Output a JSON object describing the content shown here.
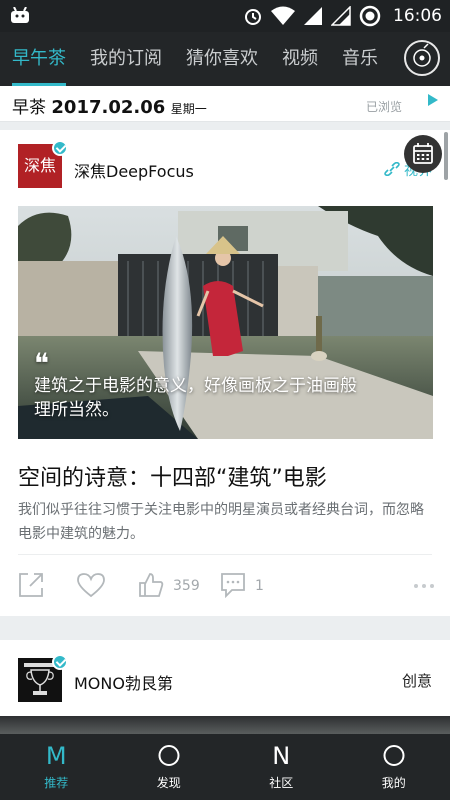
{
  "status": {
    "time": "16:06"
  },
  "nav": {
    "tabs": [
      {
        "label": "早午茶",
        "active": true
      },
      {
        "label": "我的订阅"
      },
      {
        "label": "猜你喜欢"
      },
      {
        "label": "视频"
      },
      {
        "label": "音乐"
      }
    ],
    "music_icon": "disc-icon"
  },
  "datebar": {
    "prefix": "早茶",
    "date": "2017.02.06",
    "weekday": "星期一",
    "viewed": "已浏览"
  },
  "article": {
    "source_logo_text": "深焦",
    "source_name": "深焦DeepFocus",
    "category": "视界",
    "quote": "建筑之于电影的意义，好像画板之于油画般理所当然。",
    "title": "空间的诗意：十四部“建筑”电影",
    "summary": "我们似乎往往习惯于关注电影中的明星演员或者经典台词，而忽略电影中建筑的魅力。",
    "likes": "359",
    "comments": "1"
  },
  "next_card": {
    "source_name": "MONO勃艮第",
    "category": "创意"
  },
  "bottom_nav": [
    {
      "glyph": "M",
      "label": "推荐",
      "active": true
    },
    {
      "glyph": "O",
      "label": "发现"
    },
    {
      "glyph": "N",
      "label": "社区"
    },
    {
      "glyph": "O",
      "label": "我的"
    }
  ],
  "colors": {
    "accent": "#33b9c9",
    "bar": "#232628",
    "brand_red": "#b12125"
  }
}
